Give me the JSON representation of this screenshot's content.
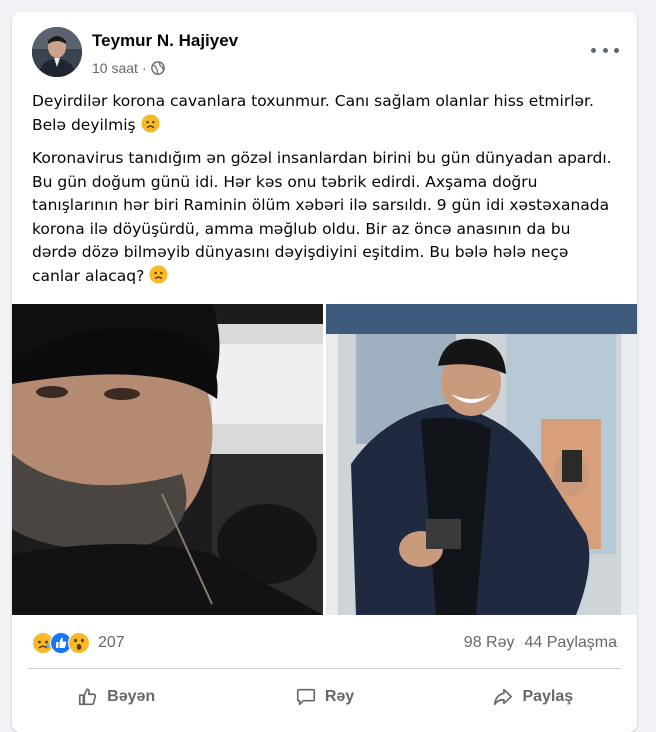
{
  "post": {
    "author": "Teymur N. Hajiyev",
    "time": "10 saat",
    "paragraph1": "Deyirdilər korona cavanlara toxunmur. Canı sağlam olanlar hiss etmirlər. Belə deyilmiş",
    "paragraph2": "Koronavirus tanıdığım ən gözəl insanlardan birini bu gün dünyadan apardı. Bu gün doğum günü idi. Hər kəs onu təbrik edirdi. Axşama doğru tanışlarının hər biri Raminin ölüm xəbəri ilə sarsıldı. 9 gün idi xəstəxanada korona ilə döyüşürdü, amma məğlub oldu. Bir az öncə anasının da bu dərdə dözə bilməyib dünyasını dəyişdiyini eşitdim. Bu bələ hələ neçə canlar alacaq?",
    "reactions_count": "207",
    "comments": "98 Rəy",
    "shares": "44 Paylaşma"
  },
  "actions": {
    "like": "Bəyən",
    "comment": "Rəy",
    "share": "Paylaş"
  },
  "icons": {
    "privacy": "globe-icon",
    "reactions": [
      "sad-reaction-icon",
      "like-reaction-icon",
      "wow-reaction-icon"
    ]
  },
  "colors": {
    "accent": "#1877f2",
    "reaction_yellow": "#f7b928",
    "secondary_text": "#65676b"
  }
}
